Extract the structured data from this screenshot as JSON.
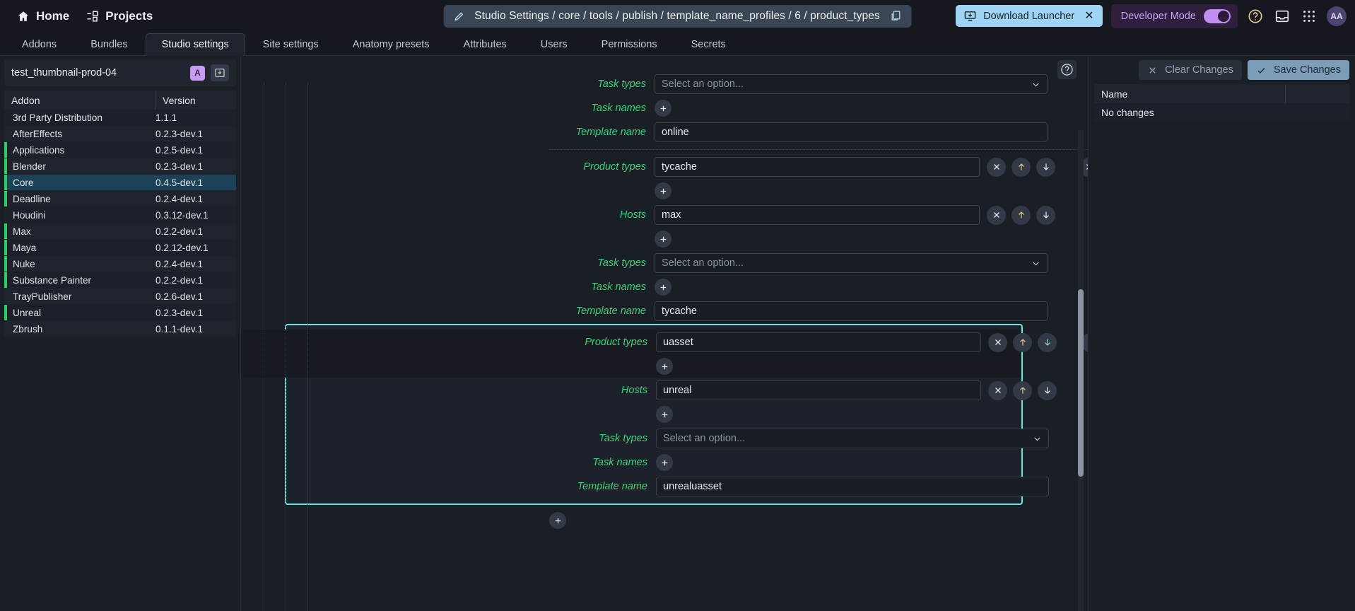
{
  "topbar": {
    "home": "Home",
    "projects": "Projects",
    "breadcrumb": "Studio Settings / core / tools / publish / template_name_profiles / 6 / product_types",
    "download_launcher": "Download Launcher",
    "download_close": "✕",
    "developer_mode": "Developer Mode",
    "avatar": "AA"
  },
  "tabs": [
    {
      "label": "Addons",
      "active": false
    },
    {
      "label": "Bundles",
      "active": false
    },
    {
      "label": "Studio settings",
      "active": true
    },
    {
      "label": "Site settings",
      "active": false
    },
    {
      "label": "Anatomy presets",
      "active": false
    },
    {
      "label": "Attributes",
      "active": false
    },
    {
      "label": "Users",
      "active": false
    },
    {
      "label": "Permissions",
      "active": false
    },
    {
      "label": "Secrets",
      "active": false
    }
  ],
  "sidebar": {
    "project_name": "test_thumbnail-prod-04",
    "badge": "A",
    "columns": [
      "Addon",
      "Version"
    ],
    "rows": [
      {
        "name": "3rd Party Distribution",
        "version": "1.1.1",
        "modified": false,
        "selected": false
      },
      {
        "name": "AfterEffects",
        "version": "0.2.3-dev.1",
        "modified": false,
        "selected": false
      },
      {
        "name": "Applications",
        "version": "0.2.5-dev.1",
        "modified": true,
        "selected": false
      },
      {
        "name": "Blender",
        "version": "0.2.3-dev.1",
        "modified": true,
        "selected": false
      },
      {
        "name": "Core",
        "version": "0.4.5-dev.1",
        "modified": true,
        "selected": true
      },
      {
        "name": "Deadline",
        "version": "0.2.4-dev.1",
        "modified": true,
        "selected": false
      },
      {
        "name": "Houdini",
        "version": "0.3.12-dev.1",
        "modified": false,
        "selected": false
      },
      {
        "name": "Max",
        "version": "0.2.2-dev.1",
        "modified": true,
        "selected": false
      },
      {
        "name": "Maya",
        "version": "0.2.12-dev.1",
        "modified": true,
        "selected": false
      },
      {
        "name": "Nuke",
        "version": "0.2.4-dev.1",
        "modified": true,
        "selected": false
      },
      {
        "name": "Substance Painter",
        "version": "0.2.2-dev.1",
        "modified": true,
        "selected": false
      },
      {
        "name": "TrayPublisher",
        "version": "0.2.6-dev.1",
        "modified": false,
        "selected": false
      },
      {
        "name": "Unreal",
        "version": "0.2.3-dev.1",
        "modified": true,
        "selected": false
      },
      {
        "name": "Zbrush",
        "version": "0.1.1-dev.1",
        "modified": false,
        "selected": false
      }
    ]
  },
  "form": {
    "labels": {
      "task_types": "Task types",
      "task_names": "Task names",
      "template_name": "Template name",
      "product_types": "Product types",
      "hosts": "Hosts"
    },
    "select_placeholder": "Select an option...",
    "profile_online": {
      "task_types_value": "Select an option...",
      "template_name_value": "online"
    },
    "profile_tycache": {
      "product_types_value": "tycache",
      "hosts_value": "max",
      "task_types_value": "Select an option...",
      "template_name_value": "tycache"
    },
    "profile_unreal": {
      "product_types_value": "uasset",
      "hosts_value": "unreal",
      "task_types_value": "Select an option...",
      "template_name_value": "unrealuasset"
    }
  },
  "changes_panel": {
    "clear_changes": "Clear Changes",
    "save_changes": "Save Changes",
    "columns": [
      "Name",
      ""
    ],
    "rows": [
      {
        "name": "No changes"
      }
    ]
  },
  "colors": {
    "accent_green": "#3fd07a",
    "highlight_cyan": "#6fe3e0",
    "modified_bar": "#2ecc5f",
    "selected_row": "#1b4256",
    "launcher_blue": "#9fd4f5",
    "devmode_purple": "#c9a4f5",
    "save_btn": "#7d9cb8"
  }
}
